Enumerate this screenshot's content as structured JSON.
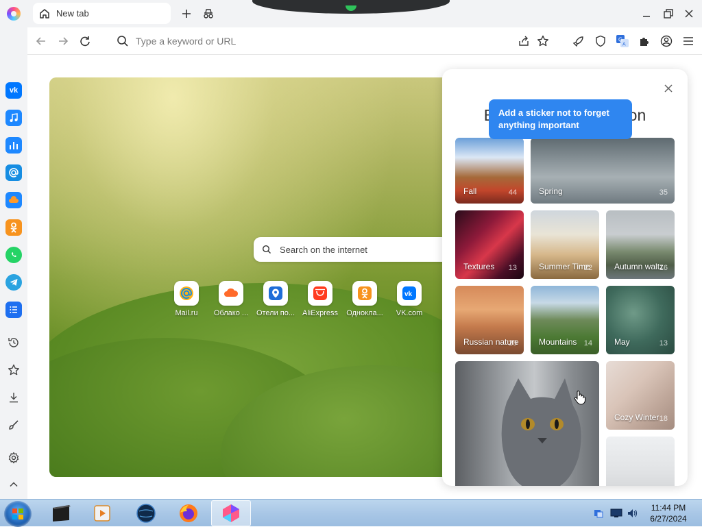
{
  "browser": {
    "tab_title": "New tab",
    "url_placeholder": "Type a keyword or URL"
  },
  "search": {
    "placeholder": "Search on the internet"
  },
  "quick_links": [
    {
      "label": "Mail.ru",
      "icon": "mailru-icon",
      "color": "#168de2"
    },
    {
      "label": "Облако ...",
      "icon": "cloud-icon",
      "color": "#ff6a2a"
    },
    {
      "label": "Отели по...",
      "icon": "hotel-pin-icon",
      "color": "#1f6ed8"
    },
    {
      "label": "AliExpress",
      "icon": "aliexpress-icon",
      "color": "#ff3b1f"
    },
    {
      "label": "Однокла...",
      "icon": "odnoklassniki-icon",
      "color": "#f7931e"
    },
    {
      "label": "VK.com",
      "icon": "vk-icon",
      "color": "#0077ff"
    }
  ],
  "panel": {
    "title": "Backgrounds collection",
    "categories": [
      {
        "label": "Fall",
        "count": "44"
      },
      {
        "label": "Spring",
        "count": "35"
      },
      {
        "label": "Textures",
        "count": "13"
      },
      {
        "label": "Summer Time",
        "count": "22"
      },
      {
        "label": "Autumn waltz",
        "count": "16"
      },
      {
        "label": "Russian nature",
        "count": "20"
      },
      {
        "label": "Mountains",
        "count": "14"
      },
      {
        "label": "May",
        "count": "13"
      },
      {
        "label": "Cozy Winter",
        "count": "18"
      }
    ]
  },
  "tooltip": {
    "text": "Add a sticker not to forget anything important"
  },
  "sidebar_apps": [
    "vk-icon",
    "music-icon",
    "stats-icon",
    "mail-icon",
    "cloud-icon",
    "odnoklassniki-icon",
    "whatsapp-icon",
    "telegram-icon",
    "tasks-icon"
  ],
  "sidebar_tools": [
    "history-icon",
    "bookmarks-icon",
    "downloads-icon",
    "customize-icon",
    "settings-icon",
    "collapse-icon"
  ],
  "taskbar": {
    "time": "11:44 PM",
    "date": "6/27/2024"
  },
  "colors": {
    "accent": "#2f86f0",
    "tooltip_bg": "#2f86f0"
  }
}
